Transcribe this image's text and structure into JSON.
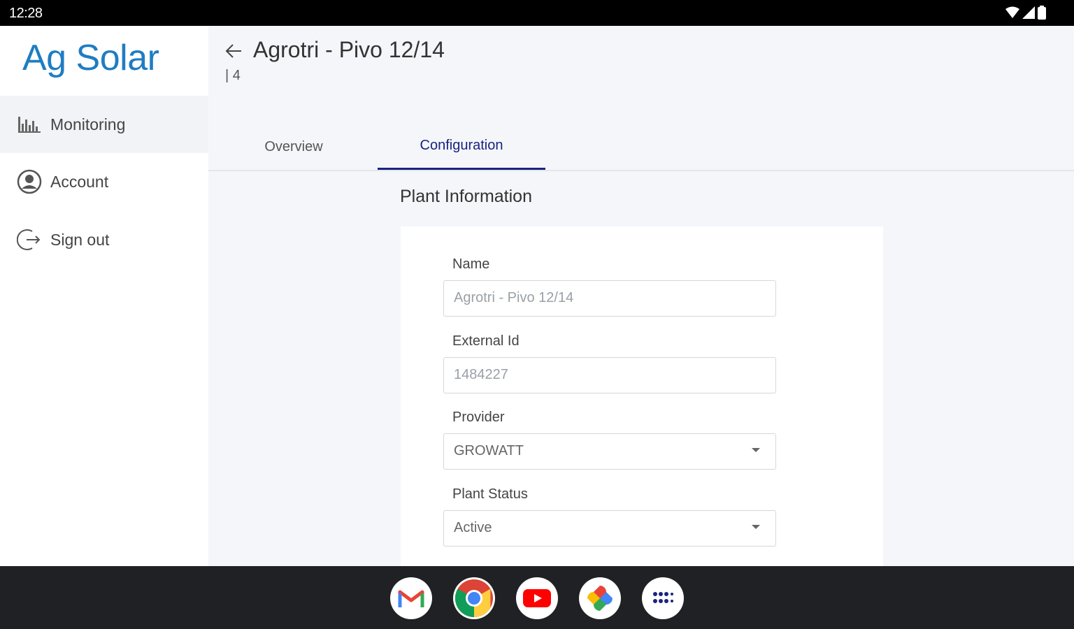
{
  "status_bar": {
    "time": "12:28"
  },
  "sidebar": {
    "brand": "Ag Solar",
    "items": [
      {
        "label": "Monitoring",
        "icon": "bar-chart-icon",
        "active": true
      },
      {
        "label": "Account",
        "icon": "account-circle-icon",
        "active": false
      },
      {
        "label": "Sign out",
        "icon": "sign-out-icon",
        "active": false
      }
    ]
  },
  "header": {
    "title": "Agrotri - Pivo 12/14",
    "subtitle": "| 4"
  },
  "tabs": [
    {
      "label": "Overview",
      "active": false
    },
    {
      "label": "Configuration",
      "active": true
    }
  ],
  "plant_info": {
    "section_title": "Plant Information",
    "fields": [
      {
        "label": "Name",
        "value": "Agrotri - Pivo 12/14"
      },
      {
        "label": "External Id",
        "value": "1484227"
      },
      {
        "label": "Provider",
        "value": "GROWATT"
      },
      {
        "label": "Plant Status",
        "value": "Active"
      }
    ]
  },
  "taskbar": {
    "apps": [
      "gmail-icon",
      "chrome-icon",
      "youtube-icon",
      "photos-icon",
      "app-launcher-icon"
    ]
  },
  "colors": {
    "brand": "#1e7dc2",
    "active_tab": "#1a237e",
    "taskbar": "#202124"
  }
}
